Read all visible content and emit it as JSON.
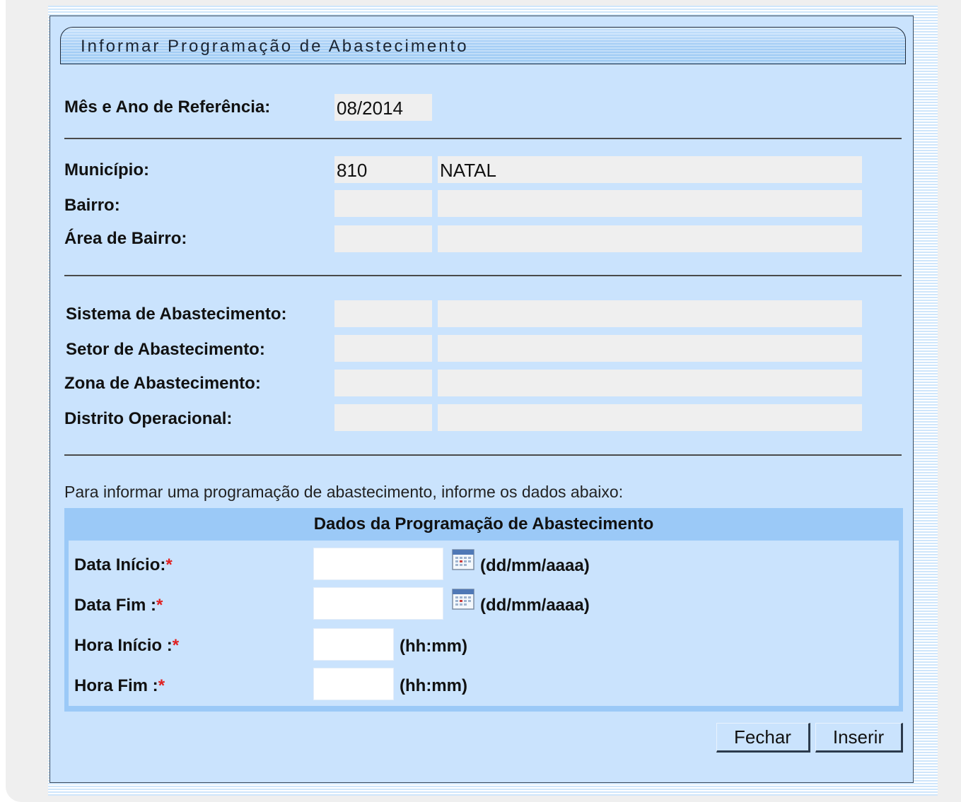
{
  "window": {
    "title": "Informar Programação de Abastecimento"
  },
  "reference": {
    "label": "Mês e Ano de Referência:",
    "value": "08/2014"
  },
  "location": {
    "municipio": {
      "label": "Município:",
      "code": "810",
      "name": "NATAL"
    },
    "bairro": {
      "label": "Bairro:",
      "code": "",
      "name": ""
    },
    "area_bairro": {
      "label": "Área de Bairro:",
      "code": "",
      "name": ""
    }
  },
  "supply": {
    "sistema": {
      "label": "Sistema de Abastecimento:",
      "code": "",
      "name": ""
    },
    "setor": {
      "label": "Setor de Abastecimento:",
      "code": "",
      "name": ""
    },
    "zona": {
      "label": "Zona de Abastecimento:",
      "code": "",
      "name": ""
    },
    "distrito": {
      "label": "Distrito Operacional:",
      "code": "",
      "name": ""
    }
  },
  "instructions": "Para informar uma programação de abastecimento, informe os dados abaixo:",
  "form": {
    "header": "Dados da Programação de Abastecimento",
    "data_inicio": {
      "label": "Data Início:",
      "required": "*",
      "value": "",
      "format": "(dd/mm/aaaa)"
    },
    "data_fim": {
      "label": "Data Fim :",
      "required": "*",
      "value": "",
      "format": "(dd/mm/aaaa)"
    },
    "hora_inicio": {
      "label": "Hora Início :",
      "required": "*",
      "value": "",
      "format": "(hh:mm)"
    },
    "hora_fim": {
      "label": "Hora Fim :",
      "required": "*",
      "value": "",
      "format": "(hh:mm)"
    },
    "icons": {
      "calendar": "calendar-icon"
    }
  },
  "buttons": {
    "close": "Fechar",
    "insert": "Inserir"
  },
  "colors": {
    "panel": "#cae3fd",
    "header_blue": "#9bc9f7",
    "readonly": "#efefef",
    "required": "#e02020"
  }
}
